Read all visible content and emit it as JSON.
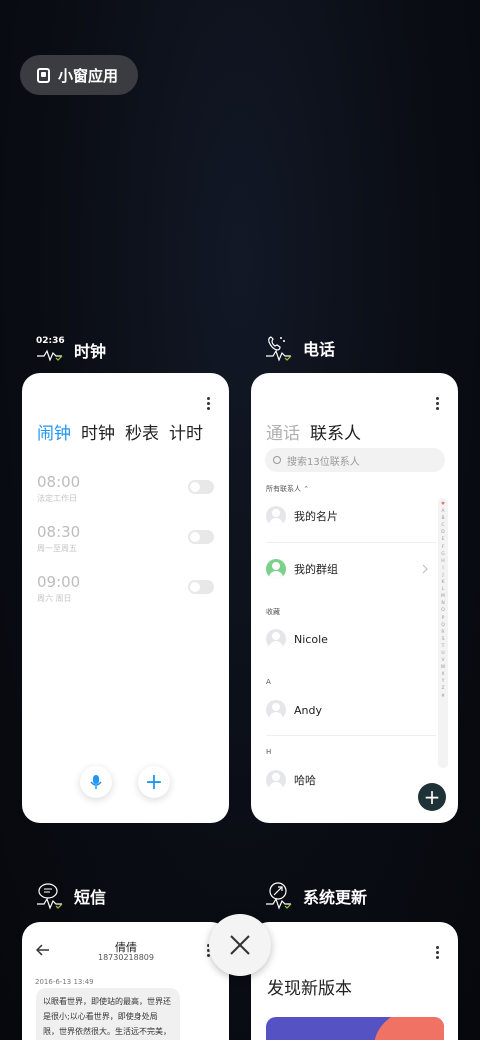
{
  "pill": {
    "label": "小窗应用"
  },
  "apps": {
    "clock": {
      "label": "时钟",
      "icon_time": "02:36",
      "tabs": [
        "闹钟",
        "时钟",
        "秒表",
        "计时"
      ],
      "alarms": [
        {
          "time": "08:00",
          "sub": "法定工作日"
        },
        {
          "time": "08:30",
          "sub": "周一至周五"
        },
        {
          "time": "09:00",
          "sub": "周六 周日"
        }
      ],
      "add_symbol": "+"
    },
    "phone": {
      "label": "电话",
      "tabs": [
        "通话",
        "联系人"
      ],
      "search_placeholder": "搜索13位联系人",
      "all_contacts": "所有联系人",
      "my_card": "我的名片",
      "my_groups": "我的群组",
      "favorites_header": "收藏",
      "contacts": [
        {
          "section": "",
          "name": "Nicole"
        },
        {
          "section": "A",
          "name": "Andy"
        },
        {
          "section": "H",
          "name": "哈哈"
        }
      ],
      "alphabet": [
        "♥",
        "A",
        "B",
        "C",
        "D",
        "E",
        "F",
        "G",
        "H",
        "I",
        "J",
        "K",
        "L",
        "M",
        "N",
        "O",
        "P",
        "Q",
        "R",
        "S",
        "T",
        "U",
        "V",
        "W",
        "X",
        "Y",
        "Z",
        "#"
      ],
      "add_symbol": "+"
    },
    "sms": {
      "label": "短信",
      "contact_name": "倩倩",
      "contact_number": "18730218809",
      "date": "2016-6-13 13:49",
      "message": "以眼看世界，即使站的最高，世界还是很小;以心看世界，即使身处局限，世界依然很大。生活远不完美，需要用心去体会;天需要有太多，要"
    },
    "update": {
      "label": "系统更新",
      "title": "发现新版本"
    }
  },
  "colors": {
    "accent_blue": "#2196f3",
    "fab_dark": "#1f3238",
    "group_green": "#7bd08c"
  }
}
